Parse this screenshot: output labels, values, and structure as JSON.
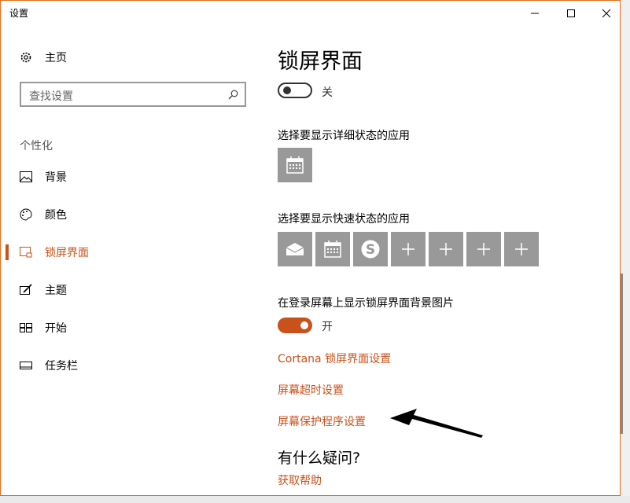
{
  "window": {
    "title": "设置"
  },
  "sidebar": {
    "home": "主页",
    "search_placeholder": "查找设置",
    "section": "个性化",
    "items": [
      {
        "label": "背景",
        "icon": "picture-icon"
      },
      {
        "label": "颜色",
        "icon": "palette-icon"
      },
      {
        "label": "锁屏界面",
        "icon": "lock-screen-icon",
        "active": true
      },
      {
        "label": "主题",
        "icon": "theme-brush-icon"
      },
      {
        "label": "开始",
        "icon": "start-tiles-icon"
      },
      {
        "label": "任务栏",
        "icon": "taskbar-icon"
      }
    ]
  },
  "main": {
    "title": "锁屏界面",
    "toggle1_state": "关",
    "detailed_heading": "选择要显示详细状态的应用",
    "quick_heading": "选择要显示快速状态的应用",
    "background_heading": "在登录屏幕上显示锁屏界面背景图片",
    "toggle2_state": "开",
    "links": [
      "Cortana 锁屏界面设置",
      "屏幕超时设置",
      "屏幕保护程序设置"
    ],
    "question": "有什么疑问?",
    "help_link": "获取帮助"
  },
  "colors": {
    "accent": "#c9511b",
    "tile": "#999999",
    "window_border": "#e66e19"
  }
}
